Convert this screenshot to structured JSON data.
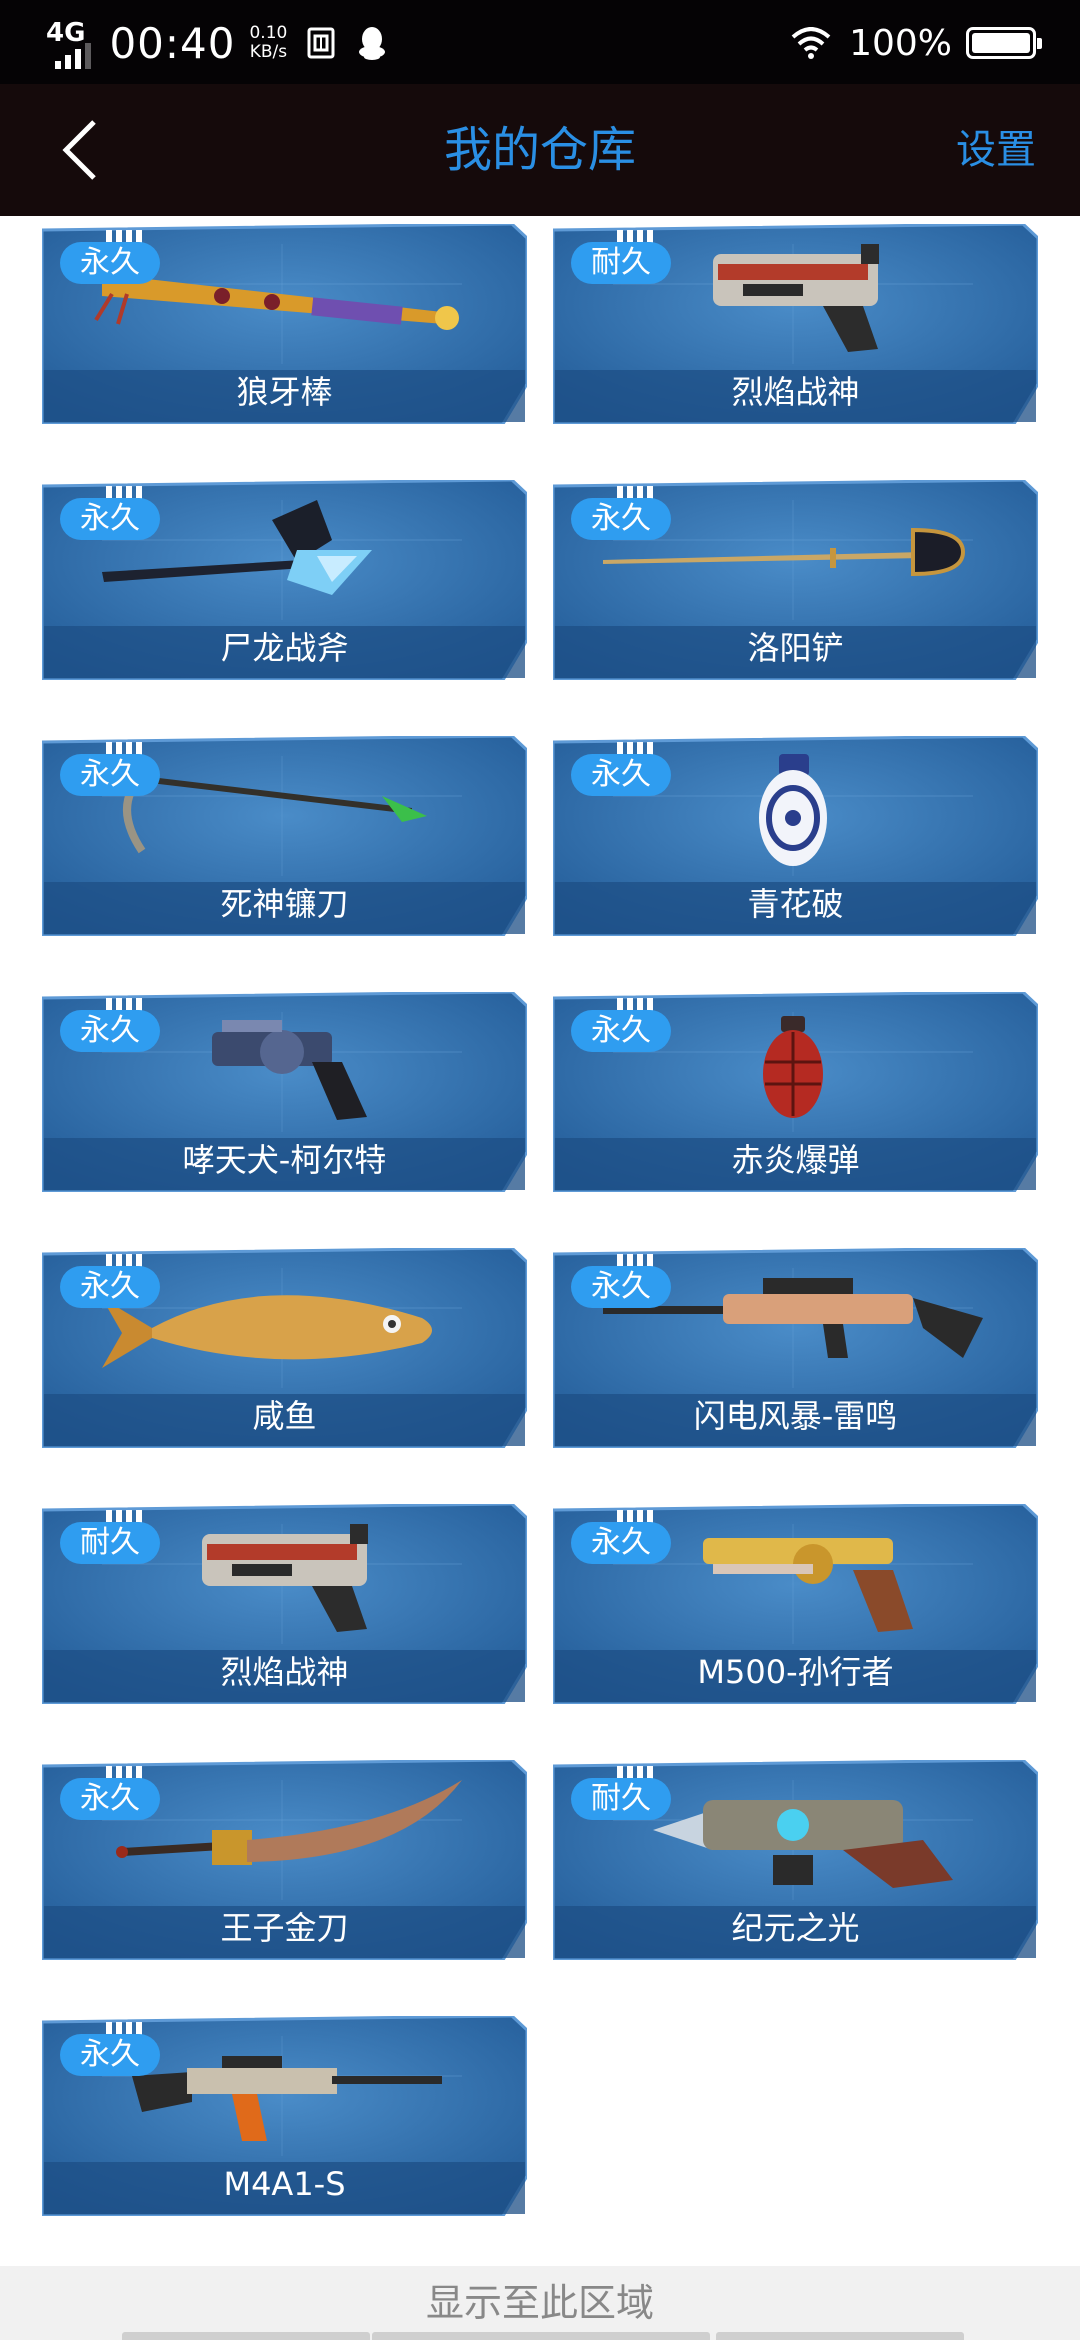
{
  "status_bar": {
    "network": "4G",
    "time": "00:40",
    "speed_value": "0.10",
    "speed_unit": "KB/s",
    "battery_percent": "100%",
    "icons": [
      "signal-icon",
      "sim-icon",
      "qq-icon",
      "wifi-icon",
      "battery-icon"
    ]
  },
  "header": {
    "title": "我的仓库",
    "settings_label": "设置",
    "back_icon": "chevron-left-icon"
  },
  "items": [
    {
      "name": "狼牙棒",
      "badge": "永久",
      "icon": "spiked-bat-icon"
    },
    {
      "name": "烈焰战神",
      "badge": "耐久",
      "icon": "blaster-gun-icon"
    },
    {
      "name": "尸龙战斧",
      "badge": "永久",
      "icon": "dragon-axe-icon"
    },
    {
      "name": "洛阳铲",
      "badge": "永久",
      "icon": "spade-staff-icon"
    },
    {
      "name": "死神镰刀",
      "badge": "永久",
      "icon": "scythe-icon"
    },
    {
      "name": "青花破",
      "badge": "永久",
      "icon": "porcelain-grenade-icon"
    },
    {
      "name": "哮天犬-柯尔特",
      "badge": "永久",
      "icon": "revolver-icon"
    },
    {
      "name": "赤炎爆弹",
      "badge": "永久",
      "icon": "red-grenade-icon"
    },
    {
      "name": "咸鱼",
      "badge": "永久",
      "icon": "fish-icon"
    },
    {
      "name": "闪电风暴-雷鸣",
      "badge": "永久",
      "icon": "rifle-icon"
    },
    {
      "name": "烈焰战神",
      "badge": "耐久",
      "icon": "blaster-gun-icon"
    },
    {
      "name": "M500-孙行者",
      "badge": "永久",
      "icon": "golden-revolver-icon"
    },
    {
      "name": "王子金刀",
      "badge": "永久",
      "icon": "golden-blade-icon"
    },
    {
      "name": "纪元之光",
      "badge": "耐久",
      "icon": "energy-gun-icon"
    },
    {
      "name": "M4A1-S",
      "badge": "永久",
      "icon": "assault-rifle-icon"
    }
  ],
  "bottom": {
    "label": "显示至此区域"
  },
  "colors": {
    "accent": "#2a8fe4",
    "card_bg": "#2e6fae",
    "badge": "#2f9df0",
    "header_bg": "#150a0b"
  }
}
